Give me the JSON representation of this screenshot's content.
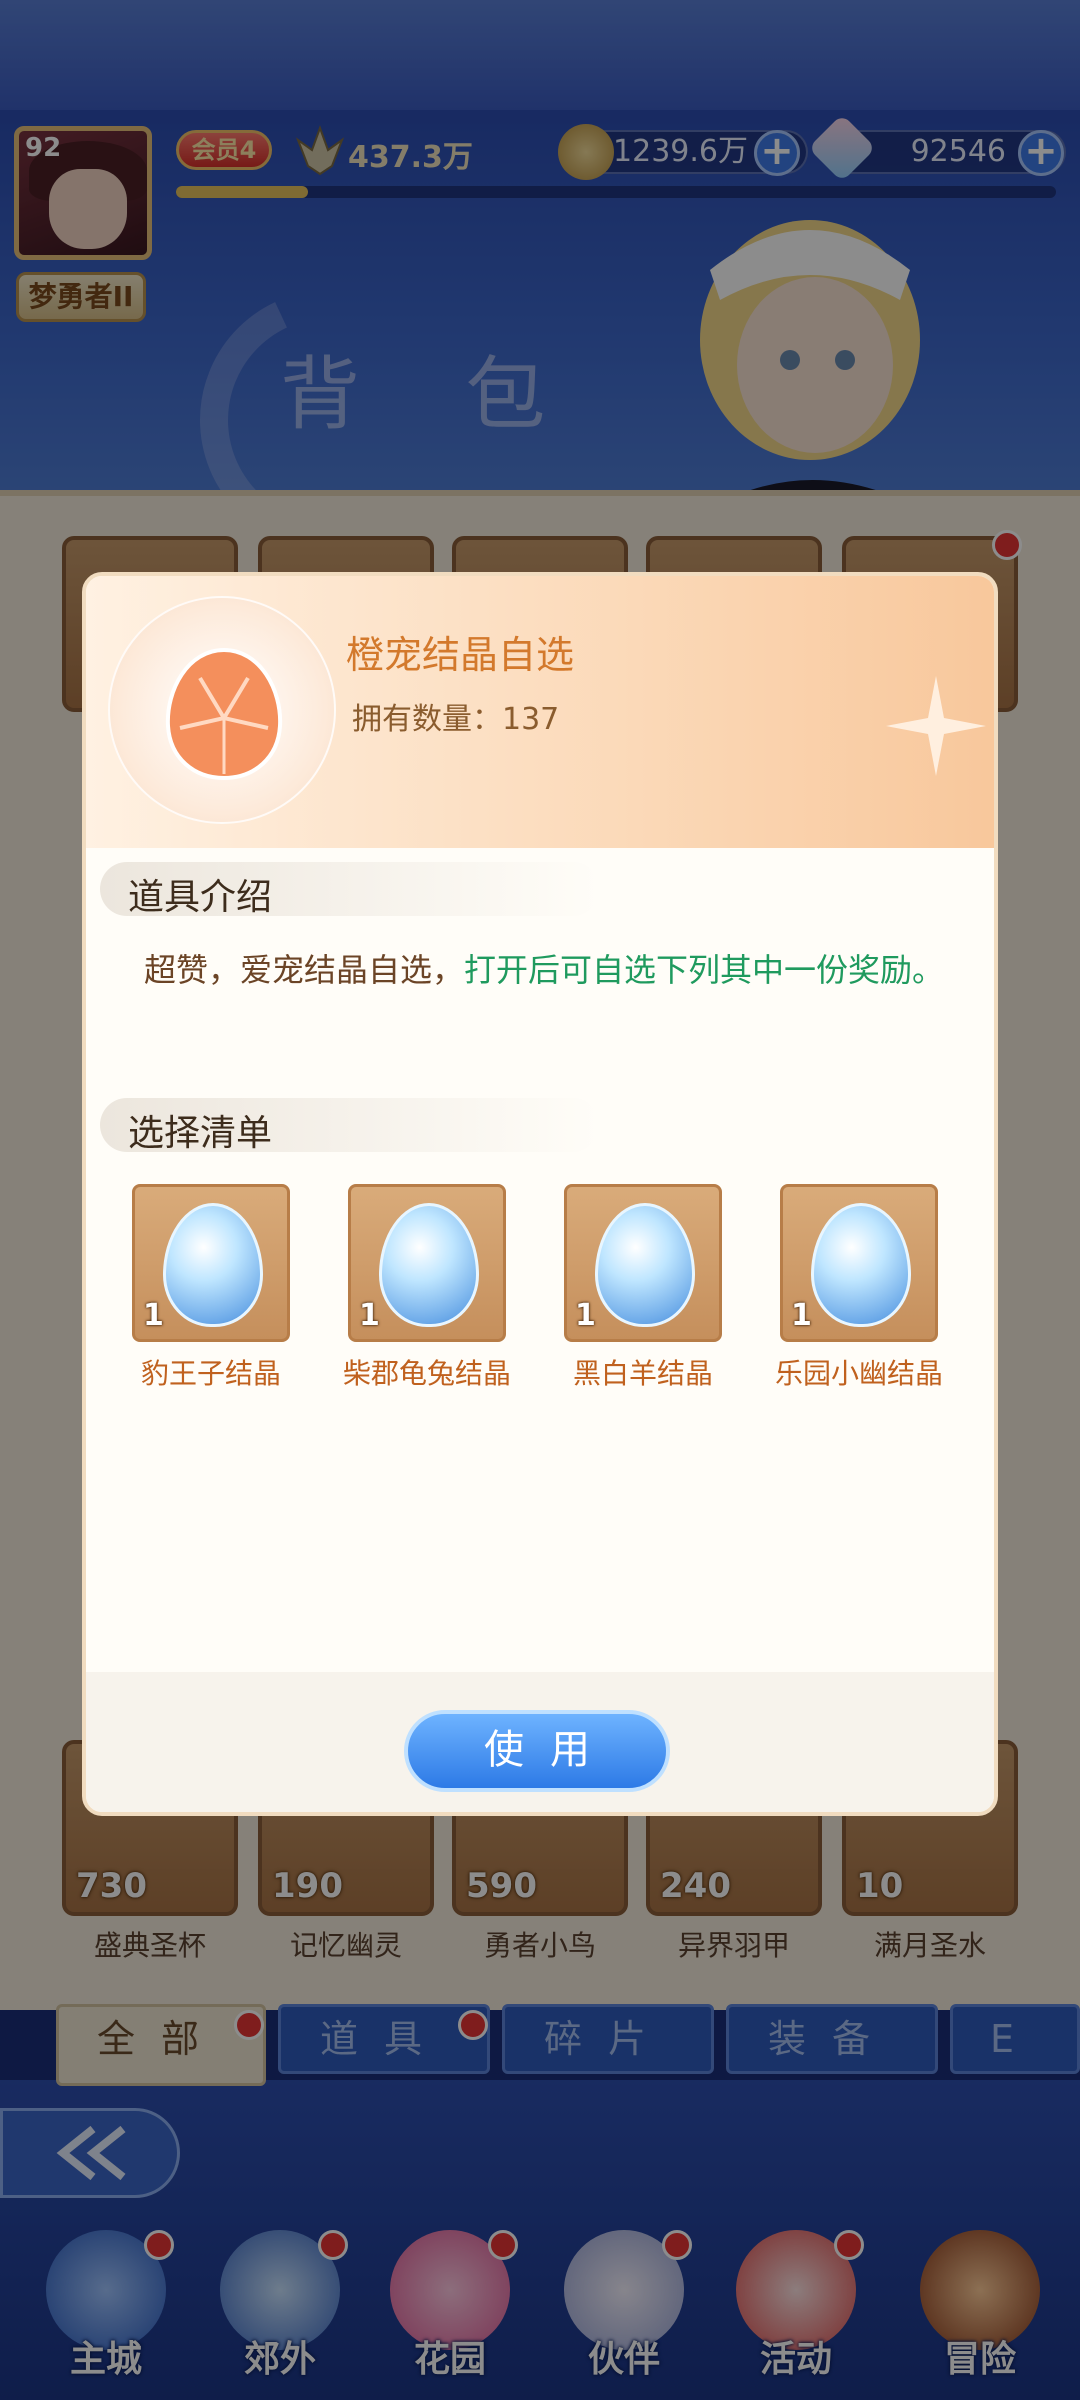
{
  "header": {
    "level": "92",
    "nickname": "梦勇者II",
    "vip": "会员4",
    "power": "437.3万",
    "exp_progress": 0.15,
    "gold": "1239.6万",
    "gems": "92546",
    "plus_symbol": "+"
  },
  "page": {
    "title": "背 包"
  },
  "inventory": {
    "bottom_row": [
      {
        "count": "730",
        "name": "盛典圣杯"
      },
      {
        "count": "190",
        "name": "记忆幽灵"
      },
      {
        "count": "590",
        "name": "勇者小鸟"
      },
      {
        "count": "240",
        "name": "异界羽甲"
      },
      {
        "count": "10",
        "name": "满月圣水"
      }
    ]
  },
  "tabs": [
    "全部",
    "道具",
    "碎片",
    "装备",
    "E"
  ],
  "modal": {
    "item_name": "橙宠结晶自选",
    "owned_label": "拥有数量：",
    "owned_count": "137",
    "section_intro": "道具介绍",
    "desc_part1": "超赞，爱宠结晶自选，",
    "desc_part2": "打开后可自选下列其中一份奖励。",
    "section_list": "选择清单",
    "pets": [
      {
        "name": "豹王子结晶",
        "count": "1"
      },
      {
        "name": "柴郡龟兔结晶",
        "count": "1"
      },
      {
        "name": "黑白羊结晶",
        "count": "1"
      },
      {
        "name": "乐园小幽结晶",
        "count": "1"
      }
    ],
    "use_button": "使用"
  },
  "nav": [
    {
      "label": "主城"
    },
    {
      "label": "郊外"
    },
    {
      "label": "花园"
    },
    {
      "label": "伙伴"
    },
    {
      "label": "活动"
    },
    {
      "label": "冒险"
    }
  ],
  "colors": {
    "accent": "#2d7ae6",
    "item_name": "#d3792c",
    "highlight_text": "#1f9a5e"
  }
}
